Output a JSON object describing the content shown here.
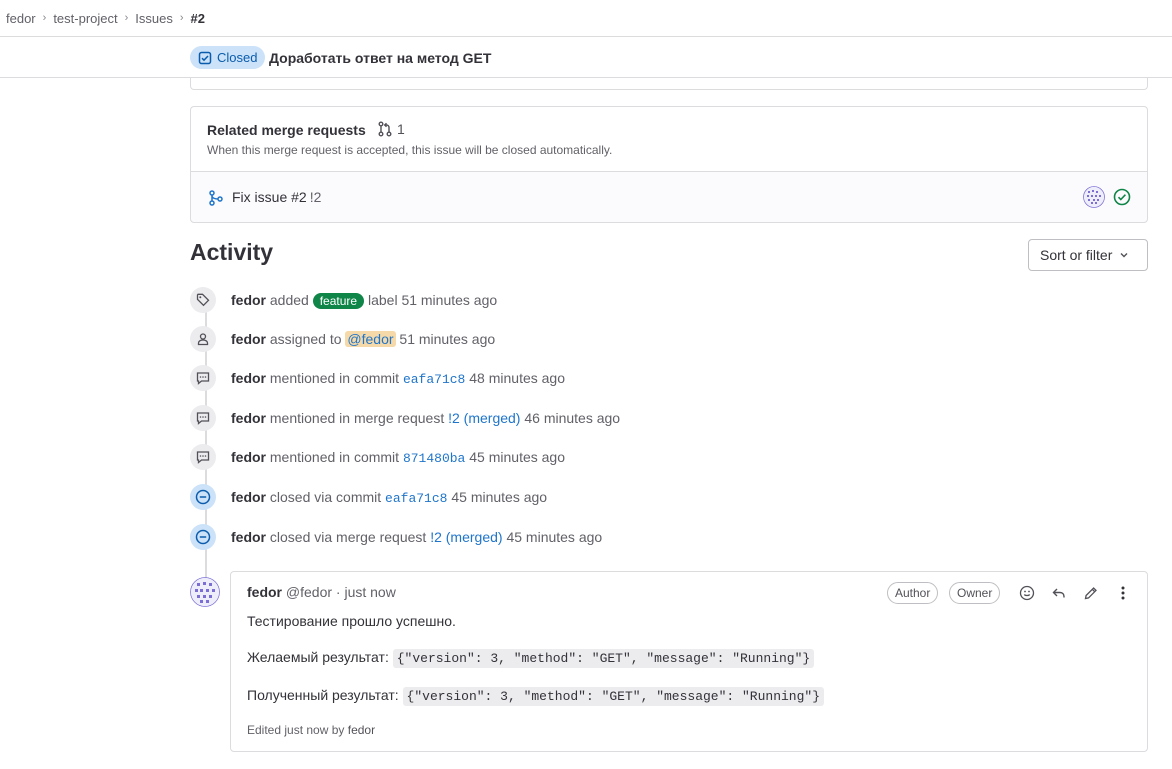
{
  "breadcrumb": {
    "items": [
      "fedor",
      "test-project",
      "Issues"
    ],
    "current": "#2"
  },
  "issue": {
    "status": "Closed",
    "title": "Доработать ответ на метод GET"
  },
  "related_mrs": {
    "title": "Related merge requests",
    "count": "1",
    "subtitle": "When this merge request is accepted, this issue will be closed automatically.",
    "items": [
      {
        "title": "Fix issue #2",
        "ref": "!2"
      }
    ]
  },
  "activity": {
    "title": "Activity",
    "sort_label": "Sort or filter",
    "events": [
      {
        "icon": "label-icon",
        "author": "fedor",
        "pre": "added",
        "label": "feature",
        "post": "label 51 minutes ago"
      },
      {
        "icon": "user-icon",
        "author": "fedor",
        "pre": "assigned to",
        "mention": "@fedor",
        "time": "51 minutes ago"
      },
      {
        "icon": "comment-icon",
        "author": "fedor",
        "pre": "mentioned in commit",
        "link": "eafa71c8",
        "time": "48 minutes ago"
      },
      {
        "icon": "comment-icon",
        "author": "fedor",
        "pre": "mentioned in merge request",
        "link": "!2 (merged)",
        "time": "46 minutes ago"
      },
      {
        "icon": "comment-icon",
        "author": "fedor",
        "pre": "mentioned in commit",
        "link": "871480ba",
        "time": "45 minutes ago"
      },
      {
        "icon": "closed-icon",
        "author": "fedor",
        "pre": "closed via commit",
        "link": "eafa71c8",
        "time": "45 minutes ago"
      },
      {
        "icon": "closed-icon",
        "author": "fedor",
        "pre": "closed via merge request",
        "link": "!2 (merged)",
        "time": "45 minutes ago"
      }
    ]
  },
  "comment": {
    "author": "fedor",
    "handle": "@fedor",
    "time": "· just now",
    "badges": [
      "Author",
      "Owner"
    ],
    "line1": "Тестирование прошло успешно.",
    "expected_label": "Желаемый результат:",
    "expected_code": "{\"version\": 3, \"method\": \"GET\", \"message\": \"Running\"}",
    "actual_label": "Полученный результат:",
    "actual_code": "{\"version\": 3, \"method\": \"GET\", \"message\": \"Running\"}",
    "edited_prefix": "Edited just now by",
    "edited_by": "fedor"
  },
  "colors": {
    "accent": "#1f75cb",
    "closed_badge_bg": "#cbe2f9",
    "label_feature": "#108548",
    "mention_bg": "#f5d9a8"
  }
}
